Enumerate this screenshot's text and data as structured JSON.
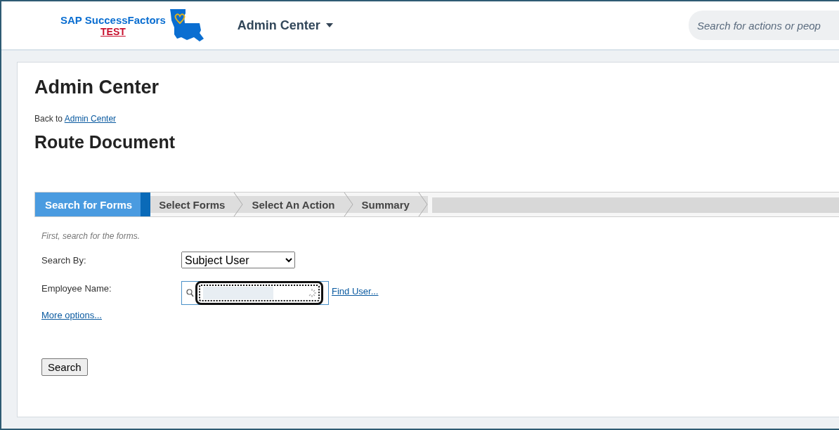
{
  "header": {
    "brand": "SAP SuccessFactors",
    "env_label": "TEST",
    "menu": "Admin Center",
    "search": {
      "placeholder": "Search for actions or peop"
    }
  },
  "page": {
    "title": "Admin Center",
    "back_prefix": "Back to",
    "back_link": "Admin Center",
    "subtitle": "Route Document"
  },
  "steps": [
    {
      "label": "Search for Forms",
      "selected": true
    },
    {
      "label": "Select Forms",
      "selected": false
    },
    {
      "label": "Select An Action",
      "selected": false
    },
    {
      "label": "Summary",
      "selected": false
    }
  ],
  "form": {
    "hint": "First, search for the forms.",
    "search_by_label": "Search By:",
    "search_by_value": "Subject User",
    "employee_label": "Employee Name:",
    "find_user": "Find User...",
    "more_options": "More options...",
    "search_button": "Search"
  }
}
